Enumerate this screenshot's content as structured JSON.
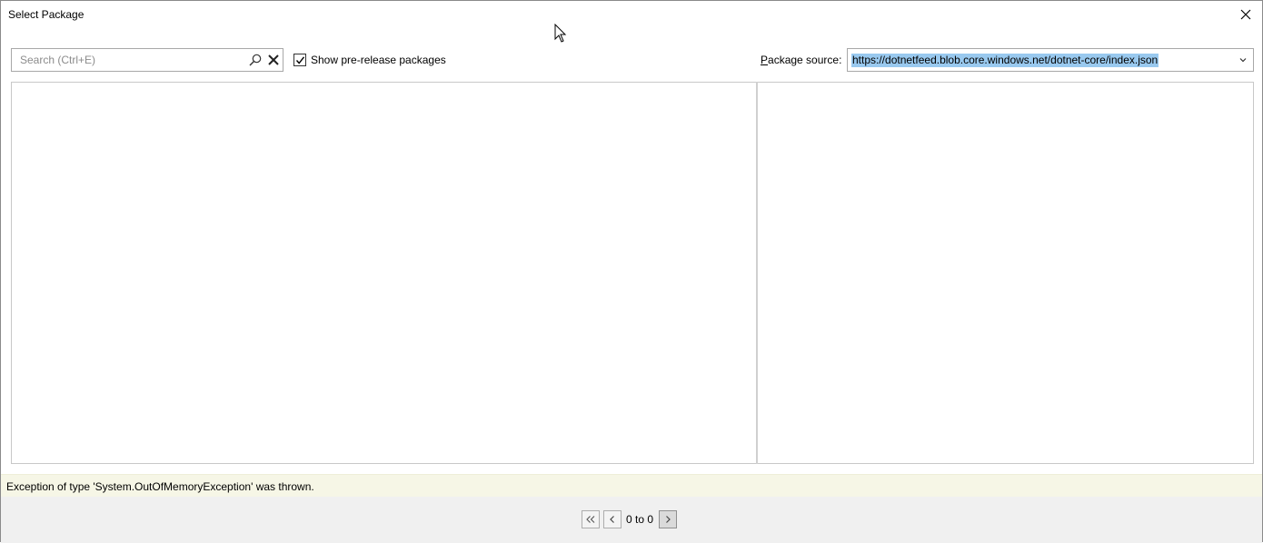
{
  "window": {
    "title": "Select Package"
  },
  "search": {
    "placeholder": "Search (Ctrl+E)",
    "value": ""
  },
  "prerelease": {
    "label": "Show pre-release packages",
    "checked": true
  },
  "source": {
    "label_accesskey": "P",
    "label_rest": "ackage source:",
    "value": "https://dotnetfeed.blob.core.windows.net/dotnet-core/index.json"
  },
  "status": {
    "error": "Exception of type 'System.OutOfMemoryException' was thrown."
  },
  "pager": {
    "range_text": "0 to 0"
  },
  "icons": {
    "close": "close-icon",
    "search": "search-icon",
    "clear": "clear-icon",
    "check": "checkmark-icon",
    "dropdown": "chevron-down-icon",
    "first": "double-chevron-left-icon",
    "prev": "chevron-left-icon",
    "next": "chevron-right-icon"
  },
  "colors": {
    "selection": "#99c9ef",
    "error_bar": "#f6f6e6",
    "footer": "#f0f0f0"
  }
}
